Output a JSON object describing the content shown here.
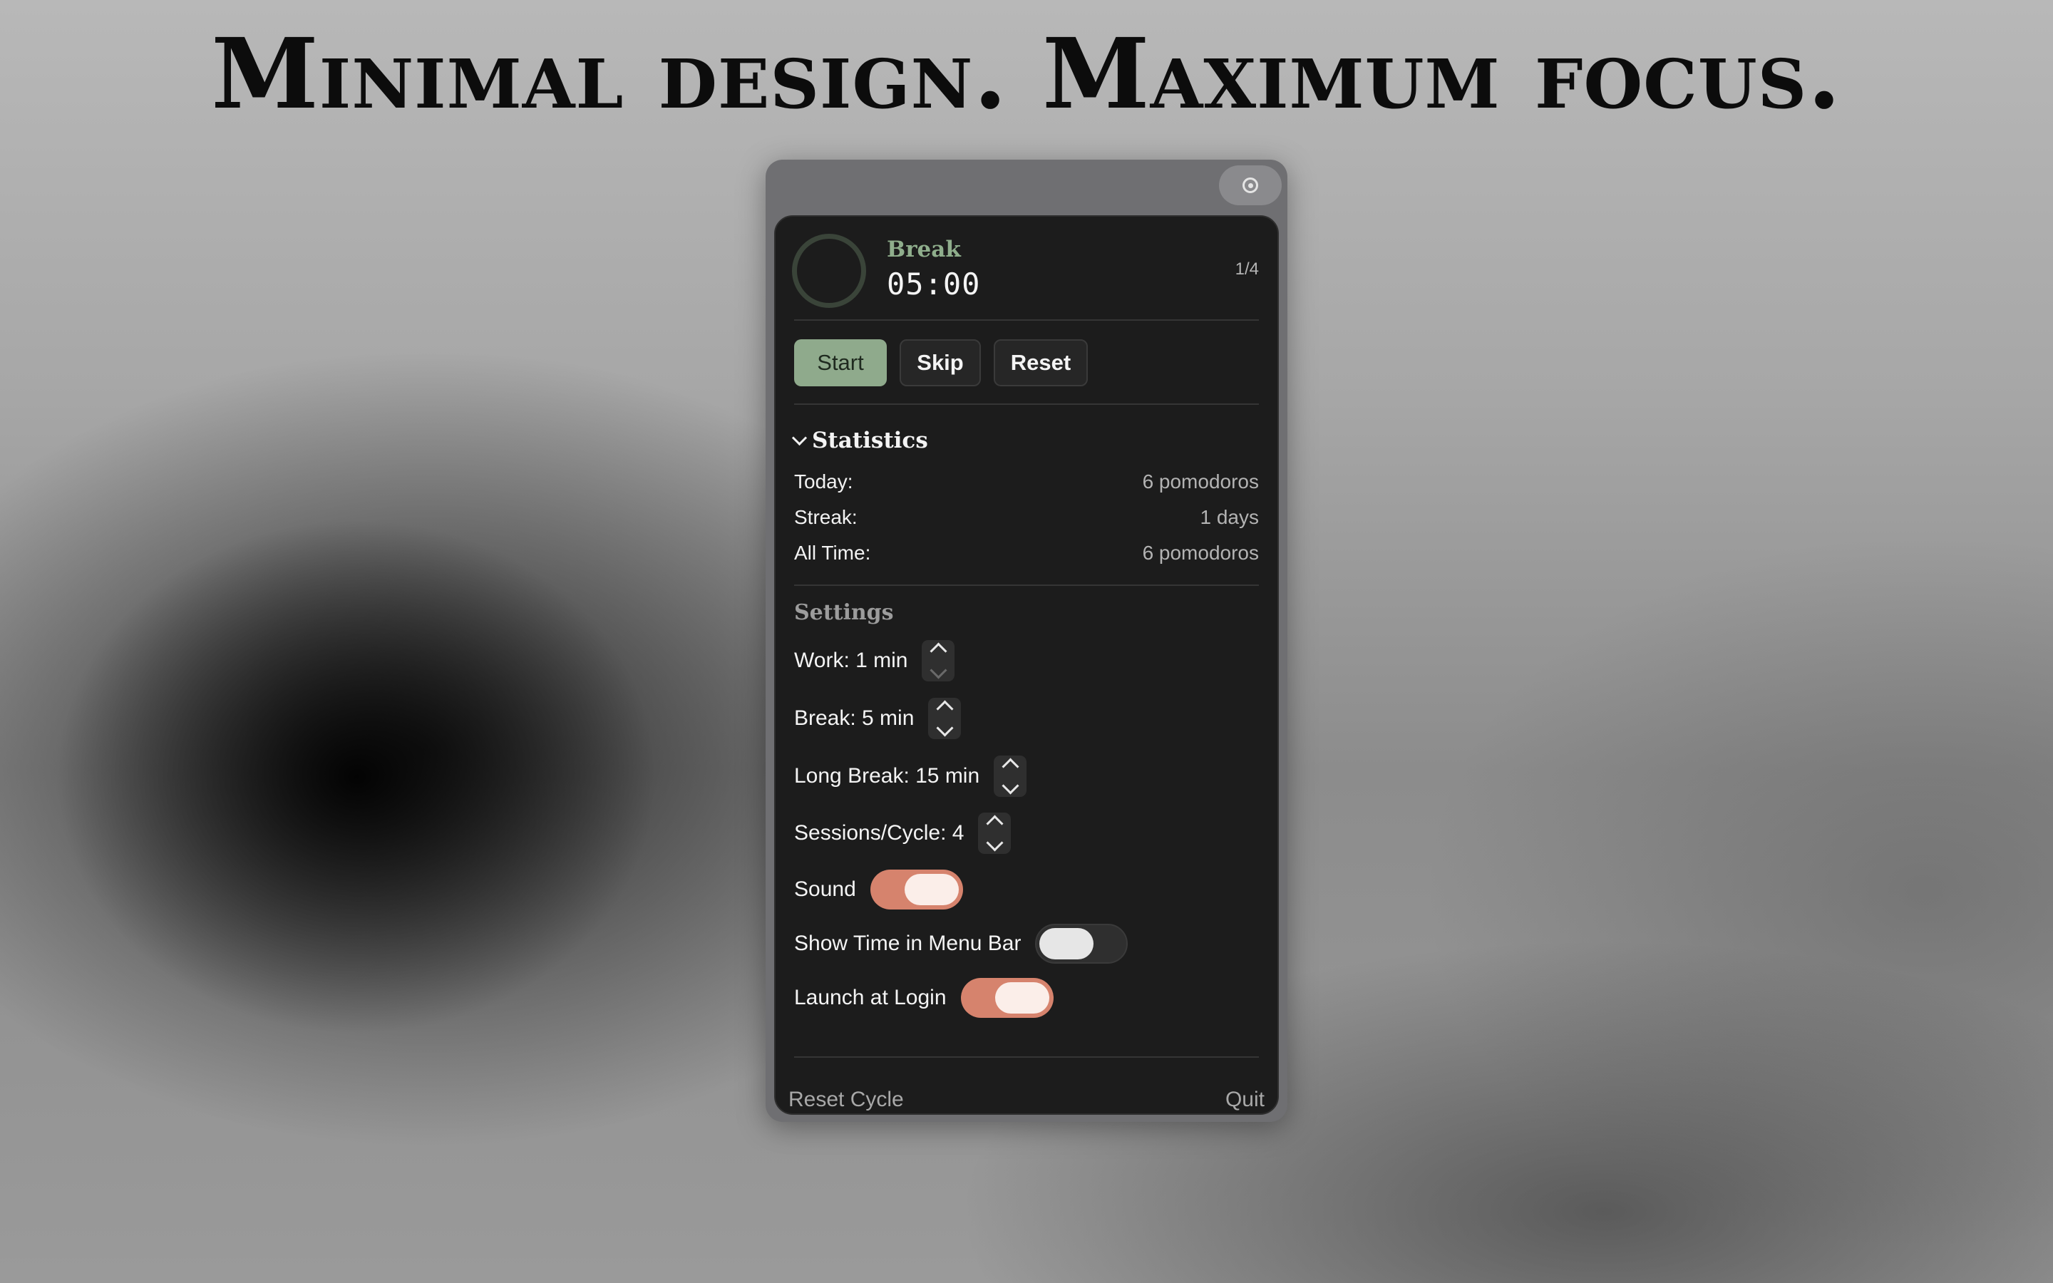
{
  "headline": "Minimal design. Maximum focus.",
  "window": {
    "title_button_icon": "record-circle-icon"
  },
  "timer": {
    "mode": "Break",
    "time": "05:00",
    "session_count": "1/4",
    "accent_color": "#8faa8c"
  },
  "controls": {
    "start_label": "Start",
    "skip_label": "Skip",
    "reset_label": "Reset"
  },
  "statistics": {
    "title": "Statistics",
    "rows": [
      {
        "label": "Today:",
        "value": "6 pomodoros"
      },
      {
        "label": "Streak:",
        "value": "1 days"
      },
      {
        "label": "All Time:",
        "value": "6 pomodoros"
      }
    ]
  },
  "settings": {
    "title": "Settings",
    "work_label": "Work: 1 min",
    "break_label": "Break: 5 min",
    "long_break_label": "Long Break: 15 min",
    "sessions_label": "Sessions/Cycle: 4",
    "sound_label": "Sound",
    "sound_on": true,
    "show_time_label": "Show Time in Menu Bar",
    "show_time_on": false,
    "launch_label": "Launch at Login",
    "launch_on": true,
    "toggle_on_color": "#d6836d"
  },
  "footer": {
    "reset_cycle_label": "Reset Cycle",
    "quit_label": "Quit"
  }
}
